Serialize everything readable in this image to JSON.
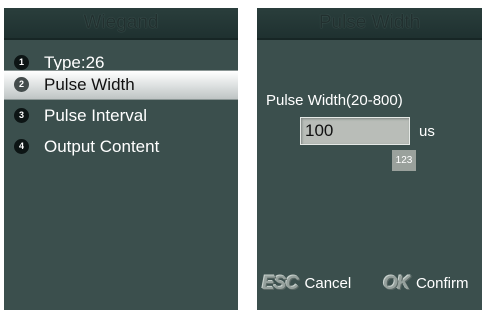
{
  "left_screen": {
    "title": "Wiegand",
    "items": [
      {
        "number": "1",
        "label": "Type:26"
      },
      {
        "number": "2",
        "label": "Pulse Width"
      },
      {
        "number": "3",
        "label": "Pulse Interval"
      },
      {
        "number": "4",
        "label": "Output Content"
      }
    ],
    "selected_index": 1
  },
  "right_screen": {
    "title": "Pulse Width",
    "field_label": "Pulse Width(20-800)",
    "value": "100",
    "unit": "us",
    "input_mode": "123",
    "softkeys": {
      "cancel_icon": "ESC",
      "cancel_label": "Cancel",
      "confirm_icon": "OK",
      "confirm_label": "Confirm"
    }
  },
  "colors": {
    "screen_bg": "#3b4f4d",
    "titlebar_bg": "#1e302f",
    "selected_bg": "#e4e7e7",
    "input_bg": "#b9bdb8",
    "badge_bg": "#9aa19c"
  }
}
